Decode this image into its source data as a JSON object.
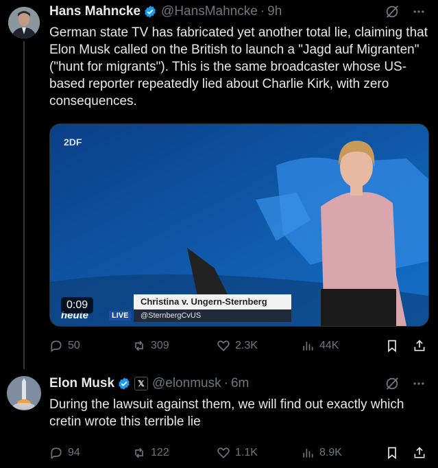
{
  "tweets": [
    {
      "name": "Hans Mahncke",
      "handle": "@HansMahncke",
      "time": "9h",
      "text": "German state TV has fabricated yet another total lie, claiming that Elon Musk called on the British to launch a \"Jagd auf Migranten\" (\"hunt for migrants\"). This is the same broadcaster whose US-based reporter repeatedly lied about Charlie Kirk, with zero consequences.",
      "media": {
        "duration": "0:09",
        "logo": "2DF",
        "lower_third_name": "Christina v. Ungern-Sternberg",
        "lower_third_handle": "@SternbergCvUS",
        "live_label": "LIVE",
        "show_label": "heute"
      },
      "stats": {
        "replies": "50",
        "reposts": "309",
        "likes": "2.3K",
        "views": "44K"
      }
    },
    {
      "name": "Elon Musk",
      "handle": "@elonmusk",
      "time": "6m",
      "text": "During the lawsuit against them, we will find out exactly which cretin wrote this terrible lie",
      "stats": {
        "replies": "94",
        "reposts": "122",
        "likes": "1.1K",
        "views": "8.9K"
      }
    }
  ],
  "icons": [
    "grok-icon",
    "more-icon",
    "reply-icon",
    "repost-icon",
    "like-icon",
    "views-icon",
    "bookmark-icon",
    "share-icon",
    "verified-icon",
    "x-affiliate-icon"
  ],
  "colors": {
    "background": "#000000",
    "text": "#e7e9ea",
    "muted": "#71767b",
    "verified": "#1d9bf0"
  }
}
